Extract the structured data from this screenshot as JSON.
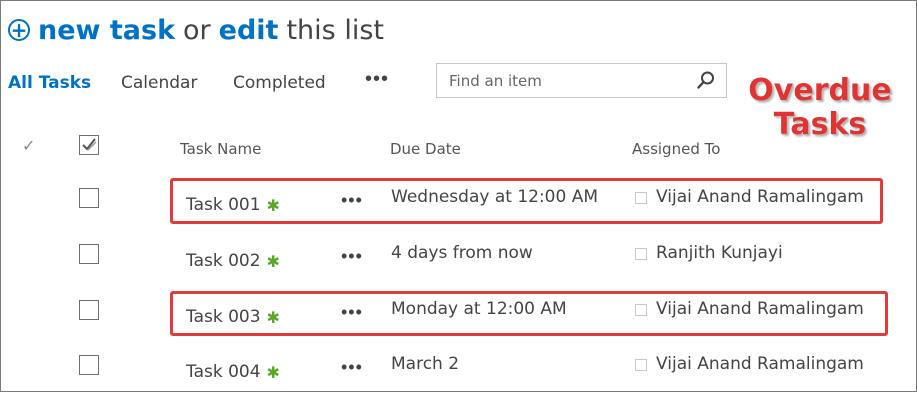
{
  "header": {
    "new_task": "new task",
    "or": "or",
    "edit": "edit",
    "this_list": "this list"
  },
  "views": {
    "all_tasks": "All Tasks",
    "calendar": "Calendar",
    "completed": "Completed",
    "more": "•••"
  },
  "search": {
    "placeholder": "Find an item"
  },
  "annotation": {
    "line1": "Overdue",
    "line2": "Tasks"
  },
  "columns": {
    "task_name": "Task Name",
    "due_date": "Due Date",
    "assigned_to": "Assigned To"
  },
  "row_menu": "•••",
  "new_marker": "✱",
  "tasks": [
    {
      "name": "Task 001",
      "due": "Wednesday at 12:00 AM",
      "assigned": "Vijai Anand Ramalingam",
      "overdue": true
    },
    {
      "name": "Task 002",
      "due": "4 days from now",
      "assigned": "Ranjith Kunjayi",
      "overdue": false
    },
    {
      "name": "Task 003",
      "due": "Monday at 12:00 AM",
      "assigned": "Vijai Anand Ramalingam",
      "overdue": true
    },
    {
      "name": "Task 004",
      "due": "March 2",
      "assigned": "Vijai Anand Ramalingam",
      "overdue": false
    }
  ],
  "colors": {
    "link": "#0072c6",
    "highlight": "#e23b3b",
    "new_icon": "#5aa82a"
  }
}
